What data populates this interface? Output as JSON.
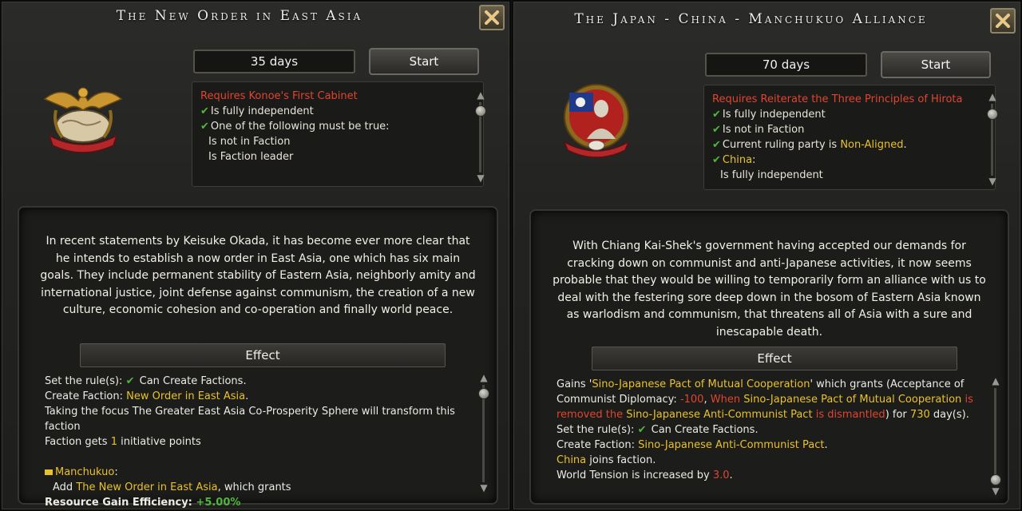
{
  "left": {
    "title": "The New Order in East Asia",
    "days": "35 days",
    "start_label": "Start",
    "requirements": {
      "requires": "Requires Konoe's First Cabinet",
      "line1": "Is fully independent",
      "line2": "One of the following must be true:",
      "line3": "Is not in Faction",
      "line4": "Is Faction leader"
    },
    "description": "In recent statements by Keisuke Okada, it has become ever more clear that he intends to establish a now order in East Asia, one which has six main goals. They include permanent stability of Eastern Asia, neighborly amity and international justice, joint defense against communism, the creation of a new culture, economic cohesion and co-operation and finally world peace.",
    "effect_label": "Effect",
    "effects": {
      "rule_prefix": "Set the rule(s):",
      "rule_value": "Can Create Factions.",
      "create_prefix": "Create Faction:",
      "create_value": "New Order in East Asia",
      "create_suffix": ".",
      "focus_text": "Taking the focus The Greater East Asia Co-Prosperity Sphere will transform this faction",
      "initiative_prefix": "Faction gets",
      "initiative_value": "1",
      "initiative_suffix": "initiative points",
      "country": "Manchukuo",
      "add_prefix": "Add",
      "add_value": "The New Order in East Asia",
      "add_suffix": ", which grants",
      "resource_prefix": "Resource Gain Efficiency:",
      "resource_value": "+5.00%"
    }
  },
  "right": {
    "title": "The Japan - China - Manchukuo Alliance",
    "days": "70 days",
    "start_label": "Start",
    "requirements": {
      "requires": "Requires Reiterate the Three Principles of Hirota",
      "line1": "Is fully independent",
      "line2": "Is not in Faction",
      "line3_prefix": "Current ruling party is",
      "line3_value": "Non-Aligned",
      "line3_suffix": ".",
      "line4": "China",
      "line4_suffix": ":",
      "line5": "Is fully independent"
    },
    "description": "With Chiang Kai-Shek's government having accepted our demands for cracking down on communist and anti-Japanese activities, it now seems probable that they would be willing to temporarily form an alliance with us to deal with the festering sore deep down in the bosom of Eastern Asia known as warlodism and communism, that threatens all of Asia with a sure and inescapable death.",
    "effect_label": "Effect",
    "effects": {
      "gains_prefix": "Gains '",
      "gains_value": "Sino-Japanese Pact of Mutual Cooperation",
      "gains_suffix": "' which grants (Acceptance of Communist Diplomacy:",
      "gains_amount": "-100",
      "gains_comma": ",",
      "when_text": "When",
      "when_pact": "Sino-Japanese Pact of Mutual Cooperation",
      "removed_text": "is removed the",
      "removed_pact": "Sino-Japanese Anti-Communist Pact",
      "dismantled_text": "is dismantled",
      "for_prefix": ") for",
      "for_value": "730",
      "for_suffix": "day(s).",
      "rule_prefix": "Set the rule(s):",
      "rule_value": "Can Create Factions.",
      "create_prefix": "Create Faction:",
      "create_value": "Sino-Japanese Anti-Communist Pact",
      "create_suffix": ".",
      "china": "China",
      "joins": "joins faction.",
      "tension_prefix": "World Tension is increased by",
      "tension_value": "3.0",
      "tension_suffix": "."
    }
  },
  "colors": {
    "red": "#e0452e",
    "yellow": "#e8c22a",
    "green_check": "#4fb83a"
  },
  "icons": [
    "close-icon",
    "checkmark-icon",
    "eagle-emblem-icon",
    "portrait-emblem-icon",
    "scroll-up-icon",
    "scroll-down-icon",
    "flag-icon"
  ]
}
